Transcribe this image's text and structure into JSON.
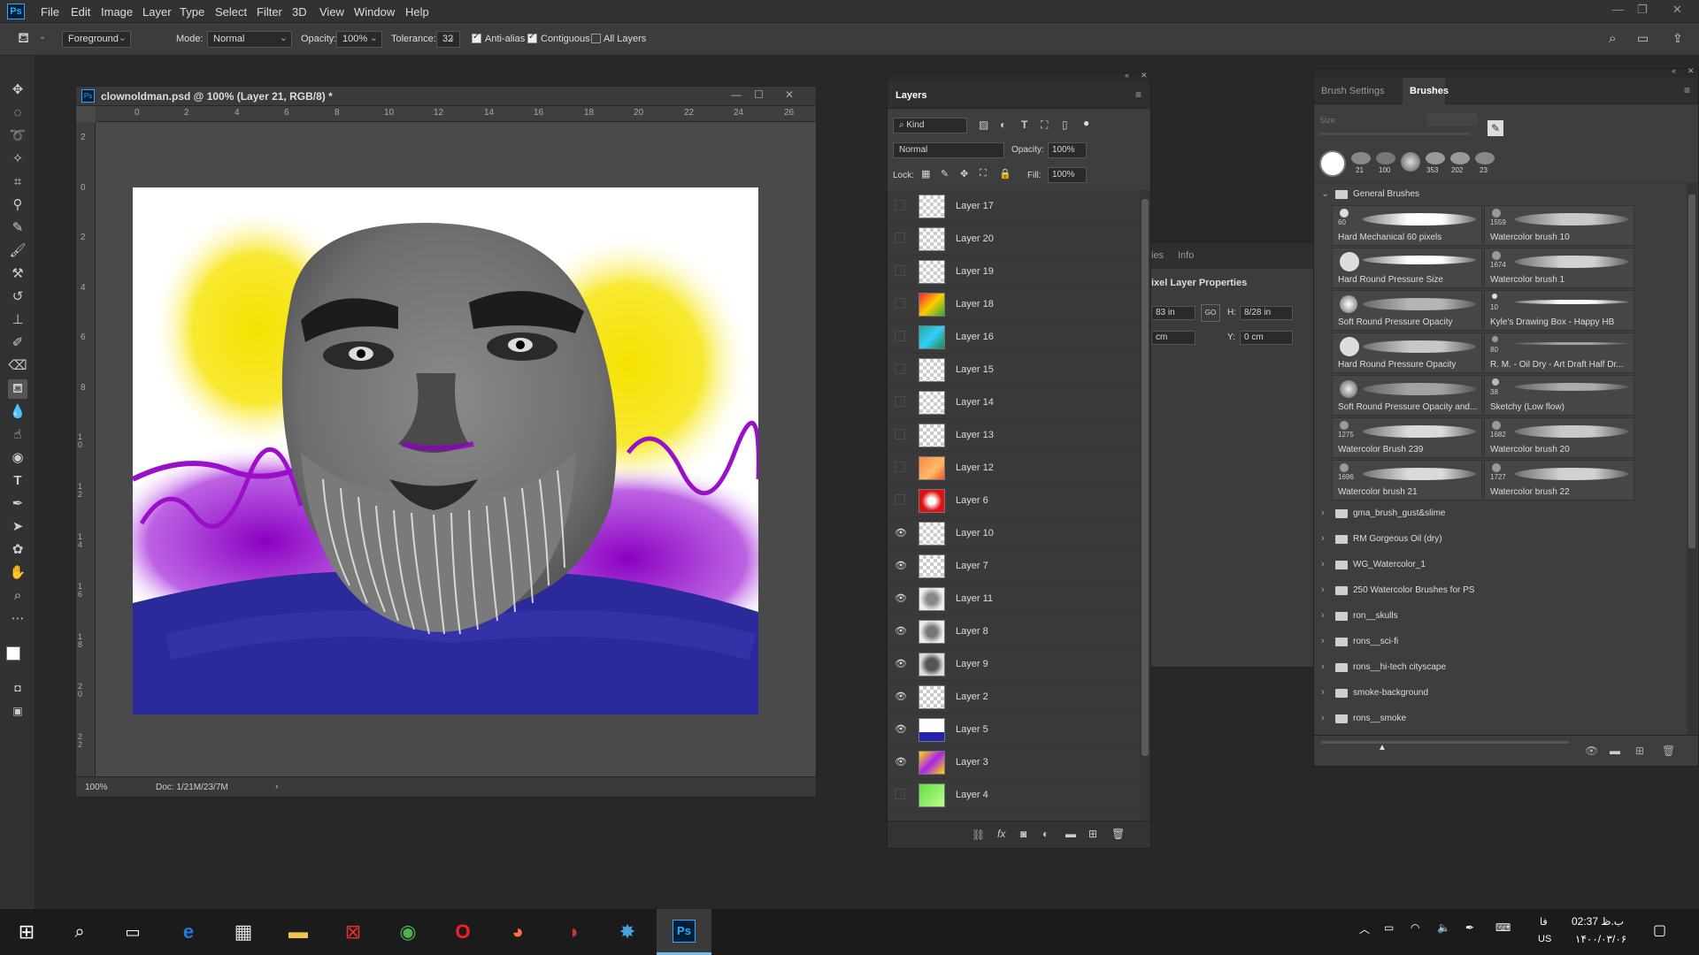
{
  "app": {
    "logo": "Ps"
  },
  "menu": [
    "File",
    "Edit",
    "Image",
    "Layer",
    "Type",
    "Select",
    "Filter",
    "3D",
    "View",
    "Window",
    "Help"
  ],
  "options": {
    "fill_source": "Foreground",
    "mode_label": "Mode:",
    "mode_value": "Normal",
    "opacity_label": "Opacity:",
    "opacity_value": "100%",
    "tolerance_label": "Tolerance:",
    "tolerance_value": "32",
    "anti_alias_label": "Anti-alias",
    "anti_alias_checked": true,
    "contiguous_label": "Contiguous",
    "contiguous_checked": true,
    "all_layers_label": "All Layers",
    "all_layers_checked": false
  },
  "document": {
    "title": "clownoldman.psd @ 100% (Layer 21, RGB/8) *",
    "ruler_h": [
      "0",
      "2",
      "4",
      "6",
      "8",
      "10",
      "12",
      "14",
      "16",
      "18",
      "20",
      "22",
      "24",
      "26"
    ],
    "ruler_v": [
      "2",
      "0",
      "2",
      "4",
      "6",
      "8",
      "1 0",
      "1 2",
      "1 4",
      "1 6",
      "1 8",
      "2 0",
      "2 2"
    ],
    "zoom": "100%",
    "doc_size": "Doc: 1/21M/23/7M"
  },
  "layers_panel": {
    "tab": "Layers",
    "filter": "Kind",
    "blend_mode": "Normal",
    "opacity_label": "Opacity:",
    "opacity_value": "100%",
    "lock_label": "Lock:",
    "fill_label": "Fill:",
    "fill_value": "100%",
    "layers": [
      {
        "name": "Layer 17",
        "visible": false
      },
      {
        "name": "Layer 20",
        "visible": false
      },
      {
        "name": "Layer 19",
        "visible": false
      },
      {
        "name": "Layer 18",
        "visible": false
      },
      {
        "name": "Layer 16",
        "visible": false
      },
      {
        "name": "Layer 15",
        "visible": false
      },
      {
        "name": "Layer 14",
        "visible": false
      },
      {
        "name": "Layer 13",
        "visible": false
      },
      {
        "name": "Layer 12",
        "visible": false
      },
      {
        "name": "Layer 6",
        "visible": false
      },
      {
        "name": "Layer 10",
        "visible": true
      },
      {
        "name": "Layer 7",
        "visible": true
      },
      {
        "name": "Layer 11",
        "visible": true
      },
      {
        "name": "Layer 8",
        "visible": true
      },
      {
        "name": "Layer 9",
        "visible": true
      },
      {
        "name": "Layer 2",
        "visible": true
      },
      {
        "name": "Layer 5",
        "visible": true
      },
      {
        "name": "Layer 3",
        "visible": true
      },
      {
        "name": "Layer 4",
        "visible": false
      }
    ]
  },
  "properties_panel": {
    "tab_a": "ies",
    "tab_b": "Info",
    "title": "ixel Layer Properties",
    "w_value": "83 in",
    "link": "GO",
    "h_label": "H:",
    "h_value": "8/28 in",
    "x_value": "cm",
    "y_label": "Y:",
    "y_value": "0 cm"
  },
  "brushes_panel": {
    "tab_settings": "Brush Settings",
    "tab_brushes": "Brushes",
    "size_label": "Size:",
    "recent_sizes": [
      "21",
      "100",
      "353",
      "202",
      "23"
    ],
    "group_name": "General Brushes",
    "brushes": [
      {
        "size": "60",
        "name": "Hard Mechanical 60 pixels"
      },
      {
        "size": "1559",
        "name": "Watercolor brush 10"
      },
      {
        "size": "",
        "name": "Hard Round Pressure Size"
      },
      {
        "size": "1674",
        "name": "Watercolor brush 1"
      },
      {
        "size": "",
        "name": "Soft Round Pressure Opacity"
      },
      {
        "size": "10",
        "name": "Kyle's Drawing Box - Happy HB"
      },
      {
        "size": "",
        "name": "Hard Round Pressure Opacity"
      },
      {
        "size": "80",
        "name": "R. M. - Oil Dry - Art Draft Half Dr..."
      },
      {
        "size": "",
        "name": "Soft Round Pressure Opacity and..."
      },
      {
        "size": "38",
        "name": "Sketchy (Low flow)"
      },
      {
        "size": "1275",
        "name": "Watercolor Brush 239"
      },
      {
        "size": "1682",
        "name": "Watercolor brush 20"
      },
      {
        "size": "1696",
        "name": "Watercolor brush 21"
      },
      {
        "size": "1727",
        "name": "Watercolor brush 22"
      }
    ],
    "folders": [
      "gma_brush_gust&slime",
      "RM Gorgeous Oil (dry)",
      "WG_Watercolor_1",
      "250 Watercolor Brushes for PS",
      "ron__skulls",
      "rons__sci-fi",
      "rons__hi-tech cityscape",
      "smoke-background",
      "rons__smoke"
    ]
  },
  "taskbar": {
    "time": "02:37 ب.ظ",
    "date": "۱۴۰۰/۰۳/۰۶",
    "lang_top": "فا",
    "lang_bottom": "US"
  },
  "colors": {
    "accent": "#31a8ff",
    "panel": "#3e3e3e",
    "bg": "#282828"
  }
}
